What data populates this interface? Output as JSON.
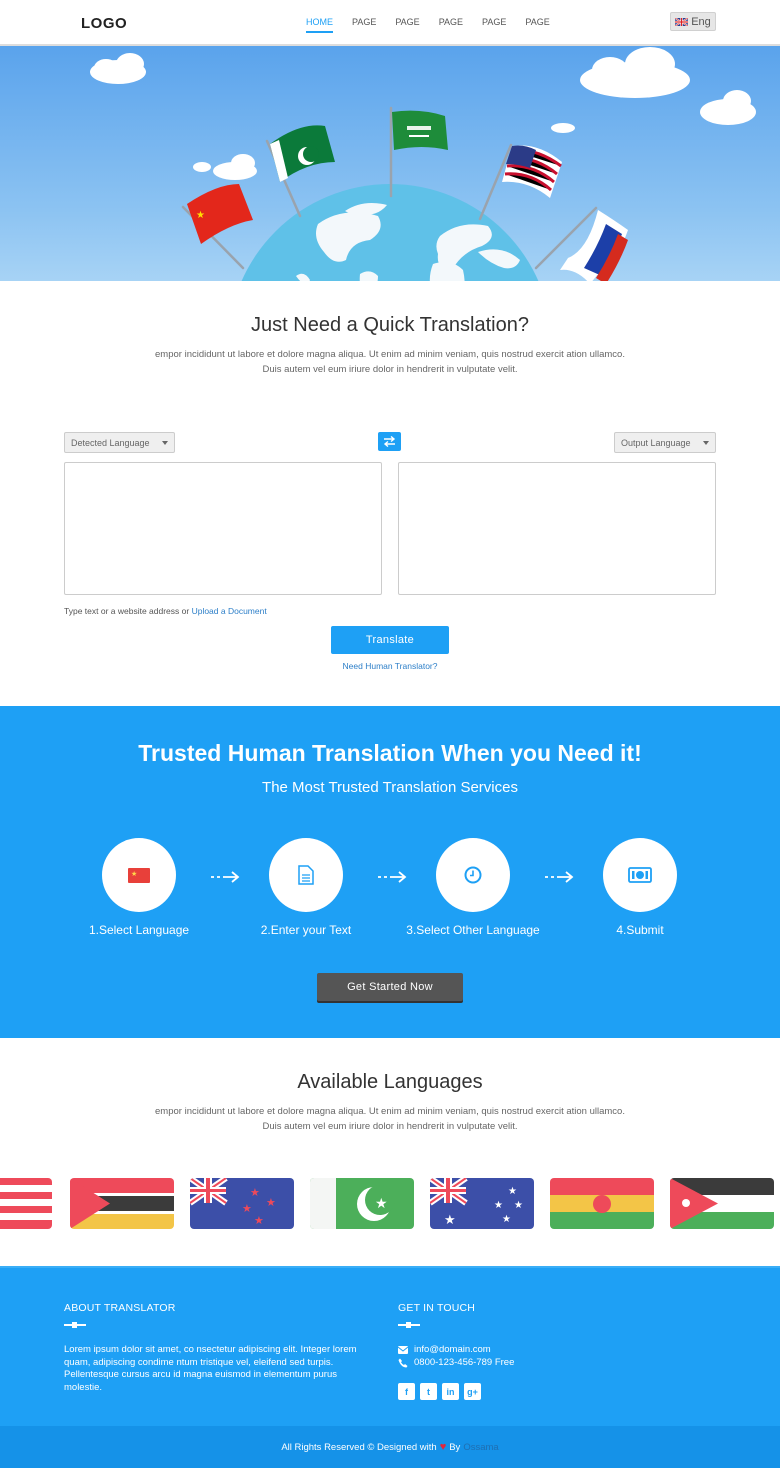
{
  "header": {
    "logo": "LOGO",
    "nav": [
      "HOME",
      "PAGE",
      "PAGE",
      "PAGE",
      "PAGE",
      "PAGE"
    ],
    "language": "Eng"
  },
  "quick": {
    "title": "Just Need a Quick Translation?",
    "text_line1": "empor incididunt ut labore et dolore magna aliqua. Ut enim ad minim veniam, quis nostrud exercit ation ullamco.",
    "text_line2": "Duis autem vel eum iriure dolor in hendrerit in vulputate velit.",
    "source_language": "Detected Language",
    "target_language": "Output Language",
    "source_text": "",
    "target_text": "",
    "hint": "Type text or a website address or",
    "upload_link": "Upload a Document",
    "translate_label": "Translate",
    "human_link": "Need Human Translator?"
  },
  "trusted": {
    "title": "Trusted Human Translation When you Need it!",
    "subtitle": "The Most Trusted Translation Services",
    "steps": [
      {
        "label": "1.Select Language",
        "icon": "flag-icon"
      },
      {
        "label": "2.Enter your Text",
        "icon": "document-icon"
      },
      {
        "label": "3.Select Other Language",
        "icon": "clock-icon"
      },
      {
        "label": "4.Submit",
        "icon": "money-icon"
      }
    ],
    "cta": "Get Started Now"
  },
  "languages": {
    "title": "Available Languages",
    "text_line1": "empor incididunt ut labore et dolore magna aliqua. Ut enim ad minim veniam, quis nostrud exercit ation ullamco.",
    "text_line2": "Duis autem vel eum iriure dolor in hendrerit in vulputate velit."
  },
  "footer": {
    "about_title": "ABOUT TRANSLATOR",
    "about_text": "Lorem ipsum dolor sit amet, co nsectetur adipiscing elit. Integer lorem quam, adipiscing condime ntum tristique vel, eleifend sed turpis. Pellentesque cursus arcu id magna euismod in elementum purus molestie.",
    "contact_title": "GET IN TOUCH",
    "email": "info@domain.com",
    "phone": "0800-123-456-789 Free",
    "social": [
      "f",
      "t",
      "in",
      "g+"
    ],
    "copyright": "All Rights Reserved © Designed with",
    "by": "By",
    "author": "Ossama"
  },
  "colors": {
    "accent": "#1ea0f5",
    "dark_button": "#555555",
    "heart": "#e0263c"
  }
}
